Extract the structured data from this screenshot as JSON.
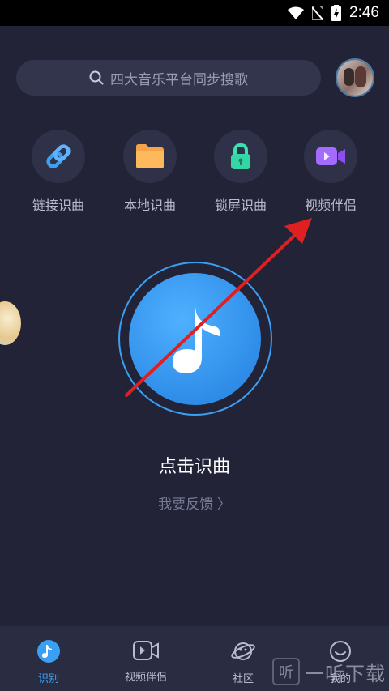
{
  "status_bar": {
    "time": "2:46"
  },
  "search": {
    "placeholder": "四大音乐平台同步搜歌"
  },
  "features": [
    {
      "label": "链接识曲",
      "icon": "link-icon"
    },
    {
      "label": "本地识曲",
      "icon": "folder-icon"
    },
    {
      "label": "锁屏识曲",
      "icon": "lock-icon"
    },
    {
      "label": "视频伴侣",
      "icon": "video-camera-icon"
    }
  ],
  "main": {
    "title": "点击识曲",
    "feedback": "我要反馈 〉"
  },
  "bottom_nav": [
    {
      "label": "识别",
      "icon": "music-note-icon",
      "active": true
    },
    {
      "label": "视频伴侣",
      "icon": "video-icon",
      "active": false
    },
    {
      "label": "社区",
      "icon": "planet-icon",
      "active": false
    },
    {
      "label": "我的",
      "icon": "smiley-icon",
      "active": false
    }
  ],
  "watermark": {
    "icon_text": "听",
    "text": "一听下载"
  },
  "colors": {
    "accent": "#3ba0f4",
    "background": "#222337",
    "arrow": "#e02020"
  }
}
